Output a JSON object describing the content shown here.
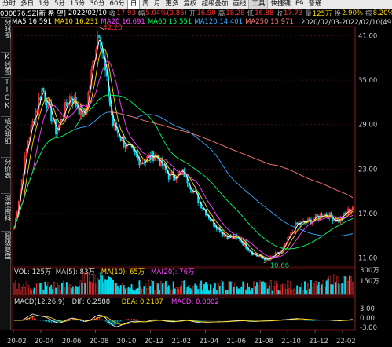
{
  "toolbar": {
    "items": [
      "分时",
      "多日",
      "1分",
      "5分",
      "15分",
      "30分",
      "60分",
      "日",
      "周",
      "月",
      "更多",
      "复权",
      "超级叠加",
      "画线",
      "工具",
      "快捷键",
      "F9",
      "普通"
    ],
    "active_index": 7
  },
  "quote": {
    "code": "000876.SZ[新 希 望]",
    "date": "2022/02/10",
    "close_label": "收",
    "close": "17.93",
    "change_label": "幅",
    "change": "5.04%(0.86)",
    "open_label": "开",
    "open": "16.90",
    "high_label": "高",
    "high": "18.28",
    "low_label": "低",
    "low": "16.88",
    "end_label": "收",
    "end": "17.73",
    "volume_label": "量",
    "volume": "125万",
    "turnover_label": "换",
    "turnover": "2.90%",
    "amp_label": "振",
    "amp": "8.20%"
  },
  "left_tabs": [
    "分时图",
    "K线图",
    "TICK",
    "成交明细",
    "分价表",
    "深度资料",
    "超级复盘"
  ],
  "ma_legend": [
    {
      "label": "MA5",
      "value": "16.591",
      "color": "#ffffff"
    },
    {
      "label": "MA10",
      "value": "16.231",
      "color": "#ffd700"
    },
    {
      "label": "MA20",
      "value": "16.691",
      "color": "#ff44ff"
    },
    {
      "label": "MA60",
      "value": "15.551",
      "color": "#00ff66"
    },
    {
      "label": "MA120",
      "value": "14.401",
      "color": "#33aaff"
    },
    {
      "label": "MA250",
      "value": "15.971",
      "color": "#ff7777"
    }
  ],
  "range_label": "2020/02/03-2022/02/10(493日)",
  "price_axis": [
    "41.00",
    "35.00",
    "29.00",
    "23.00",
    "17.00",
    "11.00"
  ],
  "annotations": {
    "high": "42.20",
    "low": "10.66"
  },
  "volume_panel": {
    "label": "VOL: 125万",
    "ma5": "MA(5): 83万",
    "ma10": "MA(10): 65万",
    "ma20": "MA(20): 76万",
    "ticks": [
      "300万",
      "150万"
    ]
  },
  "macd_panel": {
    "label": "MACD(12,26,9)",
    "dif": "DIF: 0.2588",
    "dea": "DEA: 0.2187",
    "macd": "MACD: 0.0802",
    "ticks": [
      "3.00",
      "0.00",
      "-3.00"
    ]
  },
  "date_axis": [
    "20-02",
    "20-04",
    "20-06",
    "20-08",
    "20-10",
    "20-12",
    "21-02",
    "21-04",
    "21-06",
    "21-08",
    "21-10",
    "21-12",
    "22-02"
  ],
  "colors": {
    "up": "#ff3333",
    "down": "#00ddee",
    "text_up": "#ff3333",
    "text_down": "#00cc66"
  },
  "chart_data": {
    "type": "candlestick",
    "x_range": [
      "2020/02/03",
      "2022/02/10"
    ],
    "ylim": [
      10,
      42
    ],
    "key_points": [
      {
        "date": "20-02",
        "price": 15.0
      },
      {
        "date": "20-03",
        "price": 27.0
      },
      {
        "date": "20-04",
        "price": 34.0
      },
      {
        "date": "20-05",
        "price": 28.0
      },
      {
        "date": "20-06",
        "price": 33.0
      },
      {
        "date": "20-07",
        "price": 30.0
      },
      {
        "date": "20-08",
        "price": 42.2
      },
      {
        "date": "20-09",
        "price": 29.0
      },
      {
        "date": "20-10",
        "price": 26.0
      },
      {
        "date": "20-11",
        "price": 24.0
      },
      {
        "date": "20-12",
        "price": 25.0
      },
      {
        "date": "21-01",
        "price": 22.0
      },
      {
        "date": "21-02",
        "price": 22.5
      },
      {
        "date": "21-03",
        "price": 19.0
      },
      {
        "date": "21-04",
        "price": 16.0
      },
      {
        "date": "21-05",
        "price": 14.0
      },
      {
        "date": "21-06",
        "price": 13.5
      },
      {
        "date": "21-07",
        "price": 11.5
      },
      {
        "date": "21-08",
        "price": 10.66
      },
      {
        "date": "21-09",
        "price": 12.0
      },
      {
        "date": "21-10",
        "price": 15.5
      },
      {
        "date": "21-11",
        "price": 16.0
      },
      {
        "date": "21-12",
        "price": 17.0
      },
      {
        "date": "22-01",
        "price": 16.0
      },
      {
        "date": "22-02",
        "price": 17.93
      }
    ]
  }
}
